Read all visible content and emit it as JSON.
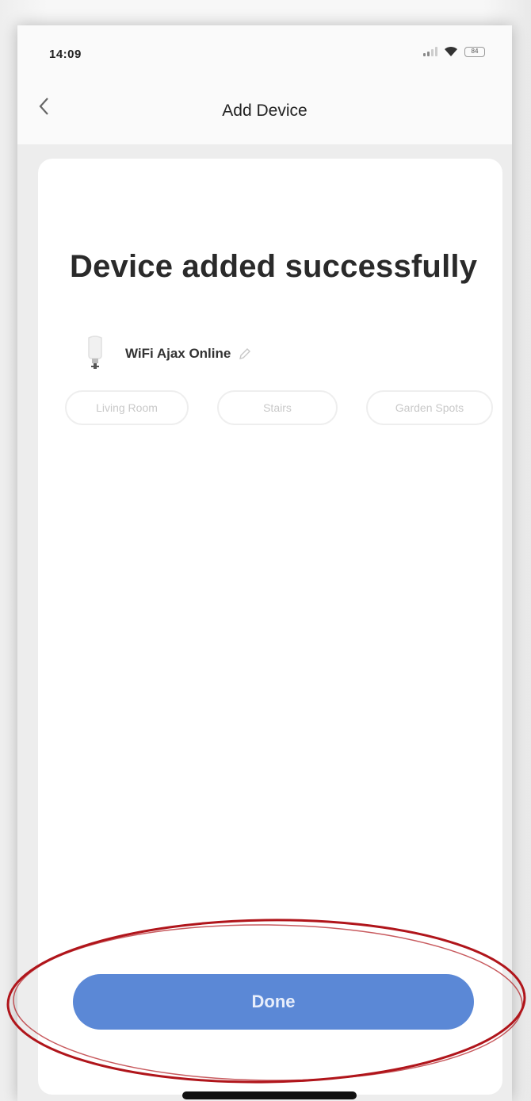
{
  "status_bar": {
    "time": "14:09",
    "battery": "84"
  },
  "nav": {
    "back_icon": "chevron-left-icon",
    "title": "Add Device"
  },
  "main": {
    "headline": "Device added successfully",
    "device": {
      "icon": "lightbulb-icon",
      "name": "WiFi Ajax Online",
      "edit_icon": "pencil-icon"
    },
    "rooms": [
      "Living Room",
      "Stairs",
      "Garden Spots"
    ],
    "done_label": "Done"
  },
  "colors": {
    "accent": "#5b88d6",
    "highlight_circle": "#b0151b"
  }
}
